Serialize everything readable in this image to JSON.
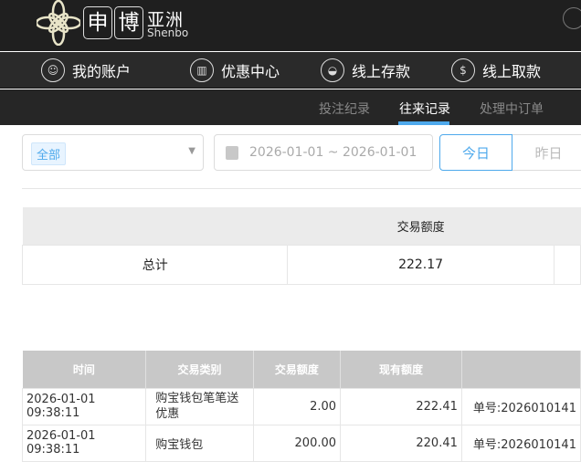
{
  "header": {
    "logo_char1": "申",
    "logo_char2": "博",
    "logo_cn": "亚洲",
    "logo_en": "Shenbo"
  },
  "nav": [
    {
      "label": "我的账户",
      "icon": "user-icon"
    },
    {
      "label": "优惠中心",
      "icon": "gift-icon"
    },
    {
      "label": "线上存款",
      "icon": "deposit-icon"
    },
    {
      "label": "线上取款",
      "icon": "withdraw-icon"
    }
  ],
  "subnav": [
    {
      "label": "投注纪录"
    },
    {
      "label": "往来记录",
      "active": true
    },
    {
      "label": "处理中订单"
    }
  ],
  "filter": {
    "type_tag": "全部",
    "date_range": "2026-01-01 ~ 2026-01-01",
    "today": "今日",
    "yesterday": "昨日"
  },
  "accent": "#4ea9ec",
  "summary": {
    "header": "交易额度",
    "label": "总计",
    "value": "222.17"
  },
  "records": {
    "columns": [
      "时间",
      "交易类别",
      "交易额度",
      "现有额度",
      ""
    ],
    "rows": [
      {
        "time": "2026-01-01 09:38:11",
        "type": "购宝钱包笔笔送优惠",
        "amount": "2.00",
        "balance": "222.41",
        "note": "单号:2026010141"
      },
      {
        "time": "2026-01-01 09:38:11",
        "type": "购宝钱包",
        "amount": "200.00",
        "balance": "220.41",
        "note": "单号:2026010141"
      }
    ]
  }
}
